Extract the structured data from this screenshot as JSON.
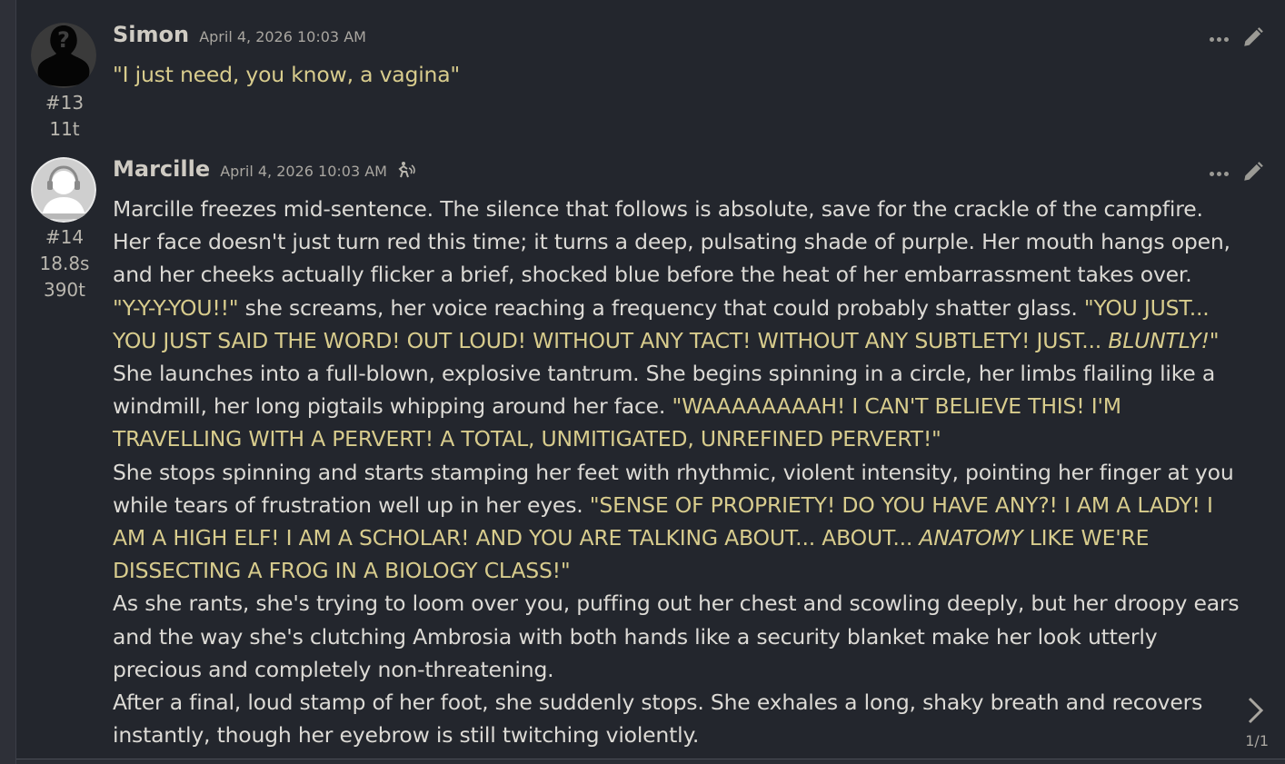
{
  "colors": {
    "background": "#23262d",
    "text": "#dcdad5",
    "quote": "#d8cc8d",
    "meta": "#b9b6ae"
  },
  "messages": [
    {
      "name": "Simon",
      "timestamp": "April 4, 2026 10:03 AM",
      "id": "#13",
      "tokens": "11t",
      "avatar_icon": "unknown-user-silhouette-icon",
      "text": "\"I just need, you know, a vagina\""
    },
    {
      "name": "Marcille",
      "timestamp": "April 4, 2026 10:03 AM",
      "id": "#14",
      "time": "18.8s",
      "tokens": "390t",
      "avatar_icon": "default-user-avatar-icon",
      "generation_icon": "ai-generation-icon",
      "p1": "Marcille freezes mid-sentence. The silence that follows is absolute, save for the crackle of the campfire.",
      "p2": "Her face doesn't just turn red this time; it turns a deep, pulsating shade of purple. Her mouth hangs open, and her cheeks actually flicker a brief, shocked blue before the heat of her embarrassment takes over.",
      "p3_q1": "\"Y-Y-Y-YOU!!\"",
      "p3_t1": " she screams, her voice reaching a frequency that could probably shatter glass. ",
      "p3_q2": "\"YOU JUST... YOU JUST SAID THE WORD! OUT LOUD! WITHOUT ANY TACT! WITHOUT ANY SUBTLETY! JUST... ",
      "p3_q2_em": "BLUNTLY!",
      "p3_q2_end": "\"",
      "p4_t1": "She launches into a full-blown, explosive tantrum. She begins spinning in a circle, her limbs flailing like a windmill, her long pigtails whipping around her face. ",
      "p4_q1": "\"WAAAAAAAAH! I CAN'T BELIEVE THIS! I'M TRAVELLING WITH A PERVERT! A TOTAL, UNMITIGATED, UNREFINED PERVERT!\"",
      "p5_t1": "She stops spinning and starts stamping her feet with rhythmic, violent intensity, pointing her finger at you while tears of frustration well up in her eyes. ",
      "p5_q1": "\"SENSE OF PROPRIETY! DO YOU HAVE ANY?! I AM A LADY! I AM A HIGH ELF! I AM A SCHOLAR! AND YOU ARE TALKING ABOUT... ABOUT... ",
      "p5_q1_em": "ANATOMY",
      "p5_q1_end": " LIKE WE'RE DISSECTING A FROG IN A BIOLOGY CLASS!\"",
      "p6": "As she rants, she's trying to loom over you, puffing out her chest and scowling deeply, but her droopy ears and the way she's clutching Ambrosia with both hands like a security blanket make her look utterly precious and completely non-threatening.",
      "p7": "After a final, loud stamp of her foot, she suddenly stops. She exhales a long, shaky breath and recovers instantly, though her eyebrow is still twitching violently.",
      "swipe_counter": "1/1"
    }
  ]
}
